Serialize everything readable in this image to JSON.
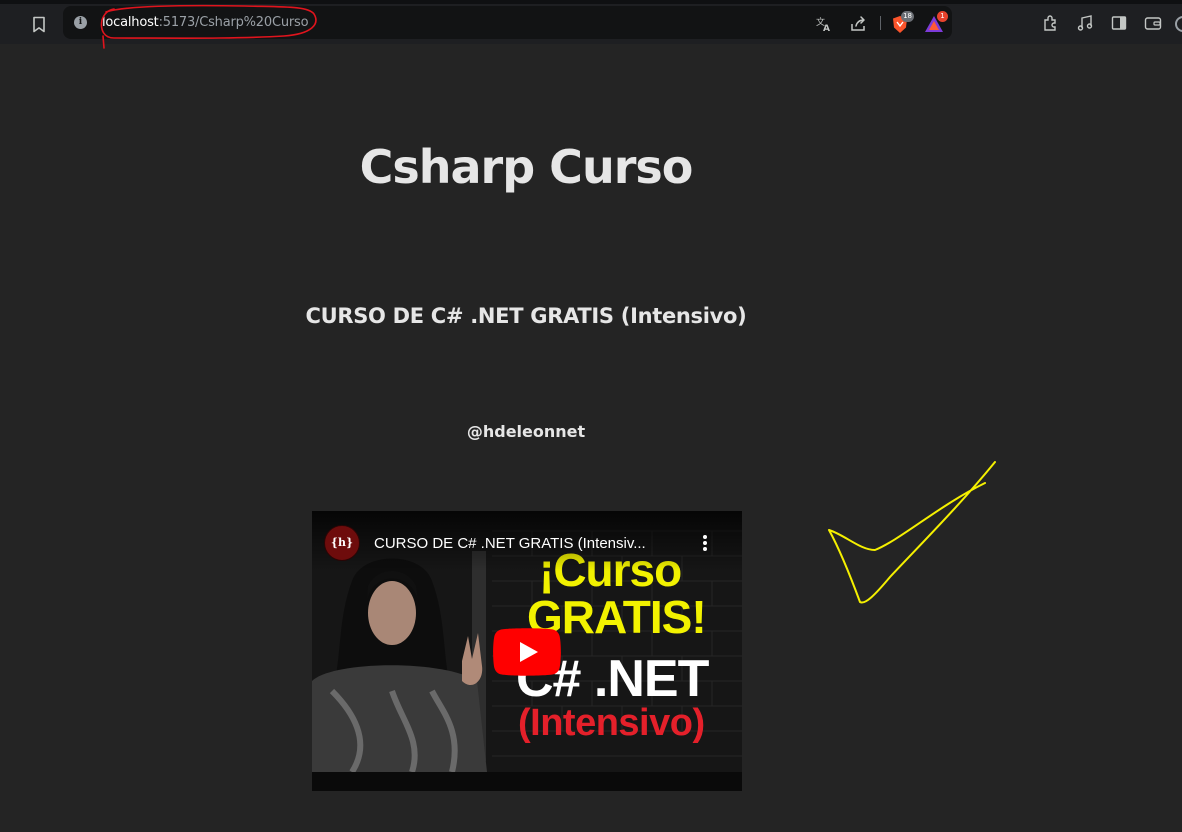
{
  "browser": {
    "url_host": "localhost",
    "url_rest": ":5173/Csharp%20Curso",
    "icons": {
      "bookmark": "bookmark-icon",
      "site_info": "info-icon",
      "translate": "translate-icon",
      "share": "share-icon",
      "brave_shields": "brave-shields-icon",
      "brave_rewards": "brave-rewards-icon",
      "extensions": "extensions-icon",
      "media": "music-note-icon",
      "sidebar": "sidebar-icon",
      "wallet": "wallet-icon"
    },
    "shields_badge": "18",
    "rewards_badge": "1",
    "info_glyph": "i"
  },
  "page": {
    "title": "Csharp Curso",
    "course_title": "CURSO DE C# .NET GRATIS (Intensivo)",
    "author": "@hdeleonnet"
  },
  "video": {
    "title": "CURSO DE C# .NET GRATIS (Intensiv...",
    "channel_logo_text": "{h}",
    "thumbnail_lines": [
      "¡Curso",
      "GRATIS!",
      "C# .NET",
      "(Intensivo)"
    ],
    "colors": {
      "highlight": "#f2f200",
      "accent": "#e4202a",
      "play_button": "#ff0000"
    }
  },
  "annotations": {
    "url_circle_color": "#e0141d",
    "checkmark_color": "#f5f000"
  }
}
